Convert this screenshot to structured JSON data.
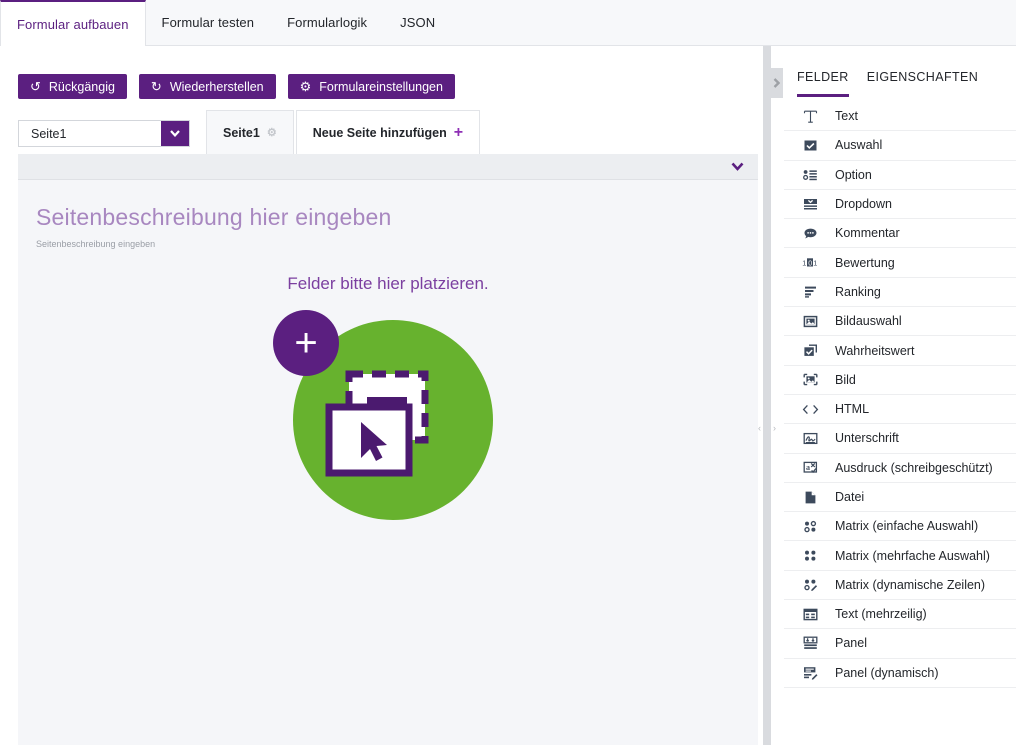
{
  "colors": {
    "purple": "#5b1f80",
    "green": "#67b22e",
    "title_purple": "#a887c0",
    "accent_plus": "#8e2fb5"
  },
  "top_tabs": [
    {
      "label": "Formular aufbauen",
      "active": true
    },
    {
      "label": "Formular testen",
      "active": false
    },
    {
      "label": "Formularlogik",
      "active": false
    },
    {
      "label": "JSON",
      "active": false
    }
  ],
  "toolbar": {
    "undo": {
      "label": "Rückgängig",
      "icon": "undo-icon",
      "glyph": "↺"
    },
    "redo": {
      "label": "Wiederherstellen",
      "icon": "redo-icon",
      "glyph": "↻"
    },
    "settings": {
      "label": "Formulareinstellungen",
      "icon": "gear-icon",
      "glyph": "⚙"
    }
  },
  "page_selector": {
    "value": "Seite1",
    "arrow_glyph": "❯"
  },
  "page_tabs": [
    {
      "label": "Seite1",
      "gear": "⚙",
      "active": true
    },
    {
      "label": "Neue Seite hinzufügen",
      "plus": "+",
      "active": false
    }
  ],
  "canvas": {
    "collapse_glyph": "❯",
    "page_title": "Seitenbeschreibung hier eingeben",
    "page_description": "Seitenbeschreibung eingeben",
    "dropzone_label": "Felder bitte hier platzieren.",
    "dropzone_plus": "+"
  },
  "splitter": {
    "left_glyph": "‹",
    "right_glyph": "›",
    "toggle_glyph": "❯"
  },
  "right_panel": {
    "tabs": [
      {
        "label": "FELDER",
        "active": true
      },
      {
        "label": "EIGENSCHAFTEN",
        "active": false
      }
    ],
    "fields": [
      {
        "label": "Text",
        "icon": "text-icon"
      },
      {
        "label": "Auswahl",
        "icon": "checkbox-icon"
      },
      {
        "label": "Option",
        "icon": "radiogroup-icon"
      },
      {
        "label": "Dropdown",
        "icon": "dropdown-icon"
      },
      {
        "label": "Kommentar",
        "icon": "comment-icon"
      },
      {
        "label": "Bewertung",
        "icon": "rating-icon"
      },
      {
        "label": "Ranking",
        "icon": "ranking-icon"
      },
      {
        "label": "Bildauswahl",
        "icon": "imagepicker-icon"
      },
      {
        "label": "Wahrheitswert",
        "icon": "boolean-icon"
      },
      {
        "label": "Bild",
        "icon": "image-icon"
      },
      {
        "label": "HTML",
        "icon": "html-icon"
      },
      {
        "label": "Unterschrift",
        "icon": "signature-icon"
      },
      {
        "label": "Ausdruck (schreibgeschützt)",
        "icon": "expression-icon"
      },
      {
        "label": "Datei",
        "icon": "file-icon"
      },
      {
        "label": "Matrix (einfache Auswahl)",
        "icon": "matrix-single-icon"
      },
      {
        "label": "Matrix (mehrfache Auswahl)",
        "icon": "matrix-multiple-icon"
      },
      {
        "label": "Matrix (dynamische Zeilen)",
        "icon": "matrix-dynamic-icon"
      },
      {
        "label": "Text (mehrzeilig)",
        "icon": "multiline-text-icon"
      },
      {
        "label": "Panel",
        "icon": "panel-icon"
      },
      {
        "label": "Panel (dynamisch)",
        "icon": "panel-dynamic-icon"
      }
    ]
  }
}
